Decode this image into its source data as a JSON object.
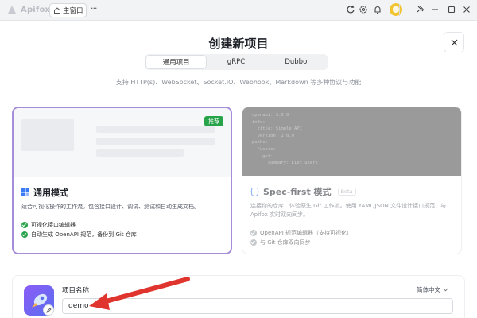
{
  "app": {
    "name": "Apifox"
  },
  "titlebar": {
    "home_tab": "主窗口",
    "more": "···"
  },
  "dialog": {
    "title": "创建新项目",
    "close": "×",
    "tabs": [
      {
        "label": "通用项目",
        "active": true
      },
      {
        "label": "gRPC",
        "active": false
      },
      {
        "label": "Dubbo",
        "active": false
      }
    ],
    "subtitle": "支持 HTTP(s)、WebSocket、Socket.IO、Webhook、Markdown 等多种协议与功能"
  },
  "cards": {
    "general": {
      "badge": "推荐",
      "title": "通用模式",
      "desc": "适合可视化操作的工作流。包含接口设计、调试、测试和自动生成文档。",
      "features": [
        "可视化接口编辑器",
        "自动生成 OpenAPI 规范，备份到 Git 仓库"
      ]
    },
    "spec": {
      "title": "Spec-first 模式",
      "beta": "Beta",
      "desc": "连接你的仓库，体验原生 Git 工作流。使用 YAML/JSON 文件设计接口规范，与 Apifox 实时双向同步。",
      "features": [
        "OpenAPI 规范编辑器（支持可视化）",
        "与 Git 仓库双向同步"
      ],
      "code_lines": [
        "openapi: 3.0.0",
        "info:",
        "  title: Simple API",
        "  version: 1.0.0",
        "paths:",
        "  /users:",
        "    get:",
        "      summary: List users"
      ]
    }
  },
  "project": {
    "label": "项目名称",
    "language": "简体中文",
    "name_value": "demo"
  },
  "colors": {
    "accent": "#a68dda",
    "green": "#27a349",
    "brand_gradient": "#8a5cf6",
    "arrow": "#e0342f"
  }
}
